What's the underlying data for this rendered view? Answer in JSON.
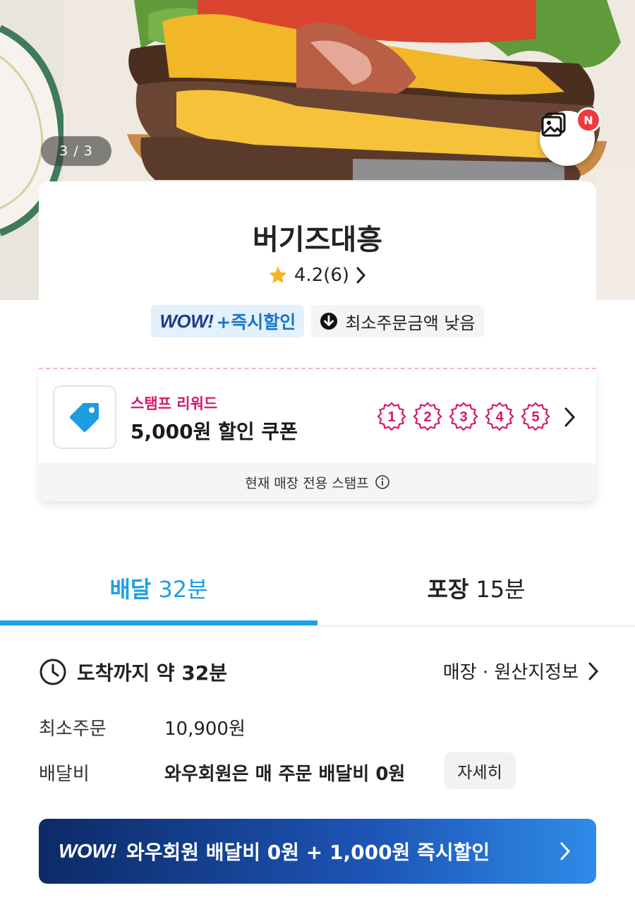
{
  "hero": {
    "photo_counter": "3 / 3",
    "gallery_badge": "N"
  },
  "store": {
    "name": "버기즈대흥",
    "rating": "4.2",
    "review_count": "(6)",
    "badge_wow_logo": "WOW!",
    "badge_wow_text": "+즉시할인",
    "badge_min_order": "최소주문금액 낮음"
  },
  "stamp": {
    "label": "스탬프 리워드",
    "title": "5,000원 할인 쿠폰",
    "circles": [
      "1",
      "2",
      "3",
      "4",
      "5"
    ],
    "footer": "현재 매장 전용 스탬프"
  },
  "tabs": {
    "delivery_label": "배달",
    "delivery_time": "32분",
    "pickup_label": "포장",
    "pickup_time": "15분"
  },
  "info": {
    "arrival": "도착까지 약 32분",
    "store_info_link": "매장 · 원산지정보",
    "min_order_label": "최소주문",
    "min_order_value": "10,900원",
    "delivery_fee_label": "배달비",
    "delivery_fee_value": "와우회원은 매 주문 배달비 0원",
    "detail_button": "자세히"
  },
  "wow_banner": {
    "logo": "WOW!",
    "text": "와우회원 배달비 0원 + 1,000원 즉시할인"
  },
  "colors": {
    "accent": "#1ea0e6",
    "stamp_pink": "#d6166e",
    "wow_navy": "#1d3c8c"
  }
}
